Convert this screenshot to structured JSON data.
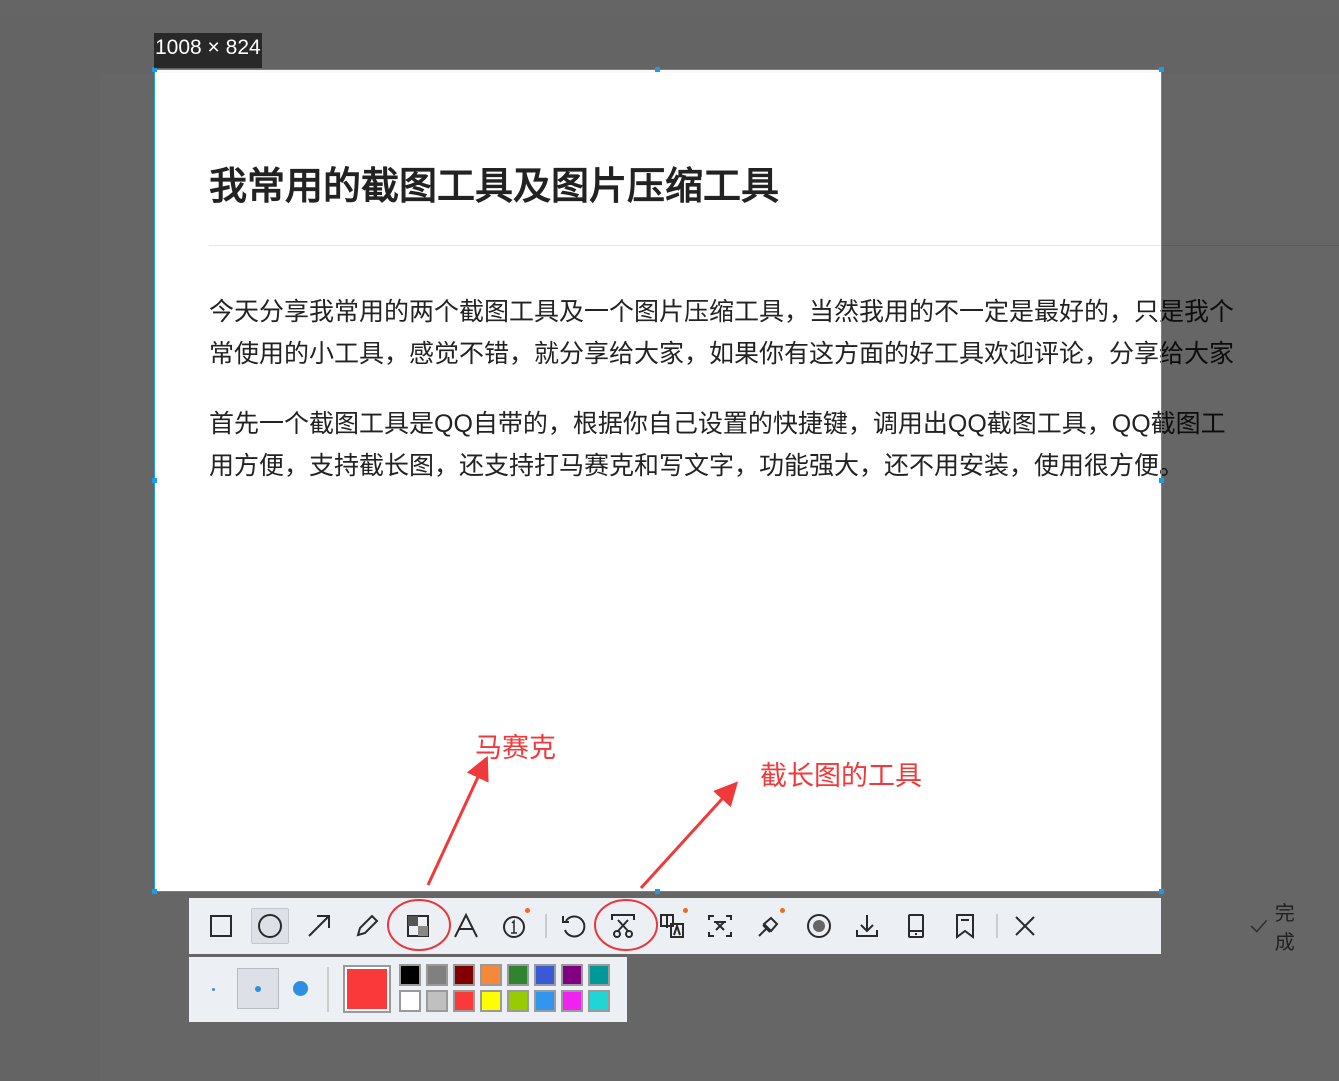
{
  "article": {
    "title": "我常用的截图工具及图片压缩工具",
    "lines": [
      "今天分享我常用的两个截图工具及一个图片压缩工具，当然我用的不一定是最好的，只是我个",
      "常使用的小工具，感觉不错，就分享给大家，如果你有这方面的好工具欢迎评论，分享给大家",
      "首先一个截图工具是QQ自带的，根据你自己设置的快捷键，调用出QQ截图工具，QQ截图工",
      "用方便，支持截长图，还支持打马赛克和写文字，功能强大，还不用安装，使用很方便。"
    ]
  },
  "selection": {
    "size_label": "1008 × 824"
  },
  "annotations": {
    "mosaic": "马赛克",
    "long_screenshot": "截长图的工具"
  },
  "toolbar": {
    "done_label": "完成"
  },
  "colors": {
    "current": "#fa3a3a",
    "swatches": [
      "#000000",
      "#808080",
      "#800000",
      "#f7883a",
      "#308430",
      "#3a59d4",
      "#800080",
      "#009999",
      "#ffffff",
      "#c0c0c0",
      "#fa3a3a",
      "#ffff00",
      "#99cc00",
      "#3296f0",
      "#f022f0",
      "#1ed6d6"
    ],
    "accent": "#1e9be8",
    "annotation": "#f0393b"
  }
}
